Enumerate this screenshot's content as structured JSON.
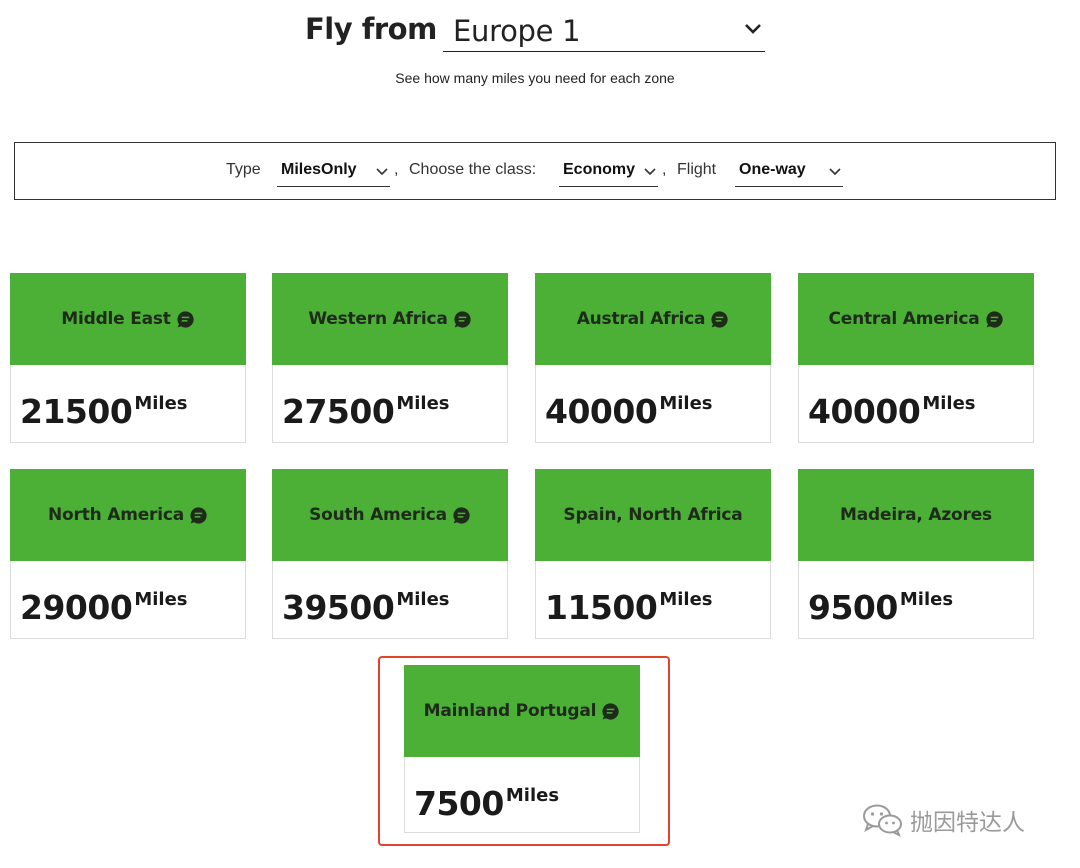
{
  "header": {
    "fly_from_label": "Fly from",
    "origin_value": "Europe 1",
    "subtitle": "See how many miles you need for each zone"
  },
  "filters": {
    "type_label": "Type",
    "type_value": "MilesOnly",
    "sep1": ",",
    "class_label": "Choose the class:",
    "class_value": "Economy",
    "sep2": ",",
    "flight_label": "Flight",
    "flight_value": "One-way"
  },
  "zones": [
    {
      "name": "Middle East",
      "miles": "21500",
      "unit": "Miles",
      "has_info_icon": true
    },
    {
      "name": "Western Africa",
      "miles": "27500",
      "unit": "Miles",
      "has_info_icon": true
    },
    {
      "name": "Austral Africa",
      "miles": "40000",
      "unit": "Miles",
      "has_info_icon": true
    },
    {
      "name": "Central America",
      "miles": "40000",
      "unit": "Miles",
      "has_info_icon": true
    },
    {
      "name": "North America",
      "miles": "29000",
      "unit": "Miles",
      "has_info_icon": true
    },
    {
      "name": "South America",
      "miles": "39500",
      "unit": "Miles",
      "has_info_icon": true
    },
    {
      "name": "Spain, North Africa",
      "miles": "11500",
      "unit": "Miles",
      "has_info_icon": false
    },
    {
      "name": "Madeira, Azores",
      "miles": "9500",
      "unit": "Miles",
      "has_info_icon": false
    },
    {
      "name": "Mainland Portugal",
      "miles": "7500",
      "unit": "Miles",
      "has_info_icon": true
    }
  ],
  "watermark": {
    "text": "抛因特达人"
  },
  "colors": {
    "card_header": "#4caf36",
    "highlight": "#e0442c"
  },
  "icons": {
    "dropdown": "chevron-down-icon",
    "info": "chat-bubble-icon",
    "watermark": "wechat-icon"
  }
}
